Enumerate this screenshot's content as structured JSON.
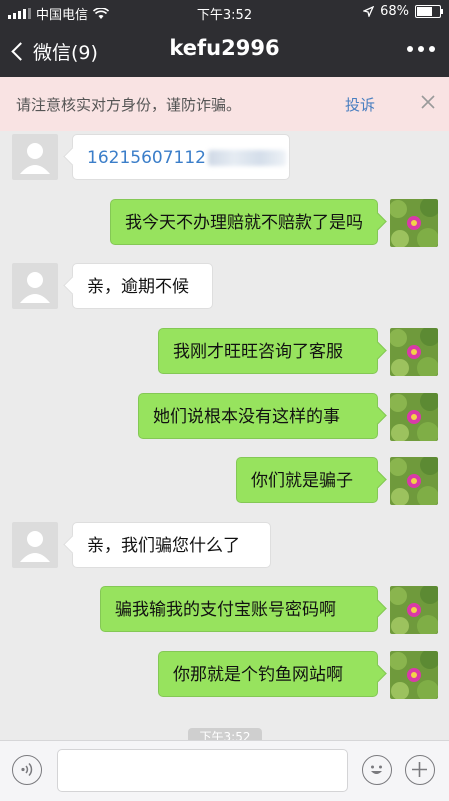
{
  "status_bar": {
    "carrier": "中国电信",
    "time": "下午3:52",
    "battery": "68%",
    "battery_level": 0.68
  },
  "nav": {
    "back_label": "微信(9)",
    "title": "kefu2996",
    "more_icon": "ellipsis-icon"
  },
  "warning": {
    "text": "请注意核实对方身份，谨防诈骗。",
    "report_label": "投诉",
    "close_icon": "close-icon"
  },
  "messages": [
    {
      "side": "left",
      "text": "16215607112",
      "blurred_suffix": true
    },
    {
      "side": "right",
      "text": "我今天不办理赔就不赔款了是吗"
    },
    {
      "side": "left",
      "text": "亲，逾期不候"
    },
    {
      "side": "right",
      "text": "我刚才旺旺咨询了客服"
    },
    {
      "side": "right",
      "text": "她们说根本没有这样的事"
    },
    {
      "side": "right",
      "text": "你们就是骗子"
    },
    {
      "side": "left",
      "text": "亲，我们骗您什么了"
    },
    {
      "side": "right",
      "text": "骗我输我的支付宝账号密码啊"
    },
    {
      "side": "right",
      "text": "你那就是个钓鱼网站啊"
    }
  ],
  "timestamp_partial": "下午3:52",
  "input_bar": {
    "voice_icon": "voice-icon",
    "emoji_icon": "emoji-icon",
    "add_icon": "plus-icon"
  }
}
